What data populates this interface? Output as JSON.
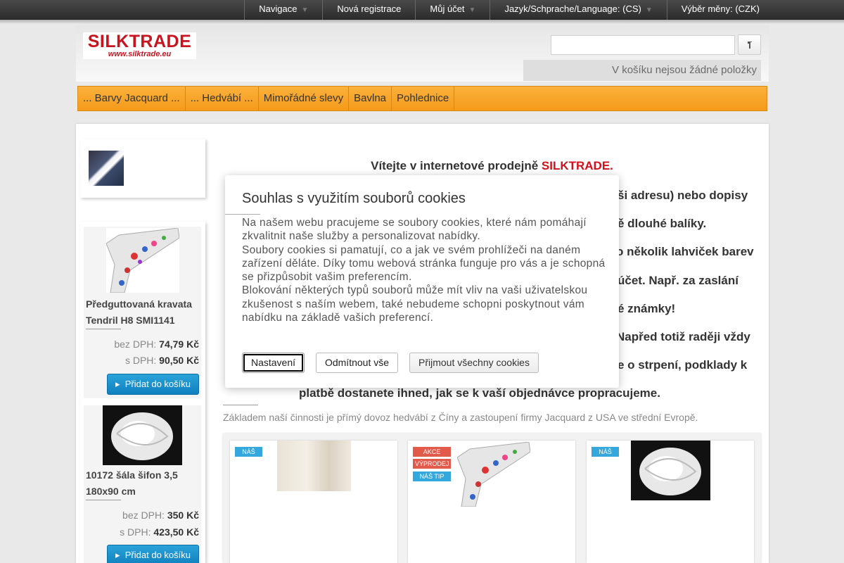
{
  "topnav": [
    {
      "label": "Navigace",
      "caret": true
    },
    {
      "label": "Nová registrace",
      "caret": false
    },
    {
      "label": "Můj účet",
      "caret": true
    },
    {
      "label": "Jazyk/Schprache/Language: (CS)",
      "caret": true
    },
    {
      "label": "Výběr měny: (CZK)",
      "caret": false
    }
  ],
  "logo": {
    "name": "SILKTRADE",
    "url": "www.silktrade.eu"
  },
  "search": {
    "placeholder": "",
    "button_icon": "search-icon"
  },
  "cart": {
    "text": "V košíku nejsou žádné položky"
  },
  "categories": [
    "... Barvy Jacquard ...",
    "... Hedvábí ...",
    "Mimořádné slevy",
    "Bavlna",
    "Pohlednice"
  ],
  "sidebar": {
    "products": [
      {
        "name": "Předguttovaná kravata Tendril H8 SMI1141",
        "price_net_label": "bez DPH:",
        "price_net": "74,79 Kč",
        "price_gross_label": "s DPH:",
        "price_gross": "90,50 Kč",
        "button": "Přidat do košíku"
      },
      {
        "name": "10172 šála šifon 3,5 180x90 cm",
        "price_net_label": "bez DPH:",
        "price_net": "350 Kč",
        "price_gross_label": "s DPH:",
        "price_gross": "423,50 Kč",
        "button": "Přidat do košíku"
      }
    ]
  },
  "content": {
    "welcome_prefix": "Vítejte v internetové prodejně ",
    "welcome_brand": "SILKTRADE.",
    "line1": "ši adresu) nebo dopisy",
    "line2": "ě dlouhé balíky.",
    "line3": "o několik lahviček barev",
    "line4": "účet. Např. za zaslání",
    "line5": "é známky!",
    "line6": "Napřed totiž raději vždy",
    "line7": "e o strpení, podklady k",
    "line8": "platbě dostanete ihned, jak se k vaší objednávce propracujeme.",
    "footer": "Základem naší činnosti je přímý dovoz hedvábí z Číny a zastoupení firmy Jacquard z USA ve střední Evropě."
  },
  "cards": [
    {
      "badges": [
        "NÁŠ TIP"
      ]
    },
    {
      "badges": [
        "AKCE",
        "VÝPRODEJ",
        "NÁŠ TIP"
      ]
    },
    {
      "badges": [
        "NÁŠ TIP"
      ]
    }
  ],
  "cookie": {
    "title": "Souhlas s využitím souborů cookies",
    "text1": "Na našem webu pracujeme se soubory cookies, které nám pomáhají zkvalitnit naše služby a personalizovat nabídky.",
    "text2": "Soubory cookies si pamatují, co a jak ve svém prohlížeči na daném zařízení děláte. Díky tomu webová stránka funguje pro vás a je schopná se přizpůsobit vašim preferencím.",
    "text3": "Blokování některých typů souborů může mít vliv na vaši uživatelskou zkušenost s naším webem, také nebudeme schopni poskytnout vám nabídku na základě vašich preferencí.",
    "btn_settings": "Nastavení",
    "btn_reject": "Odmítnout vše",
    "btn_accept": "Přijmout všechny cookies"
  }
}
